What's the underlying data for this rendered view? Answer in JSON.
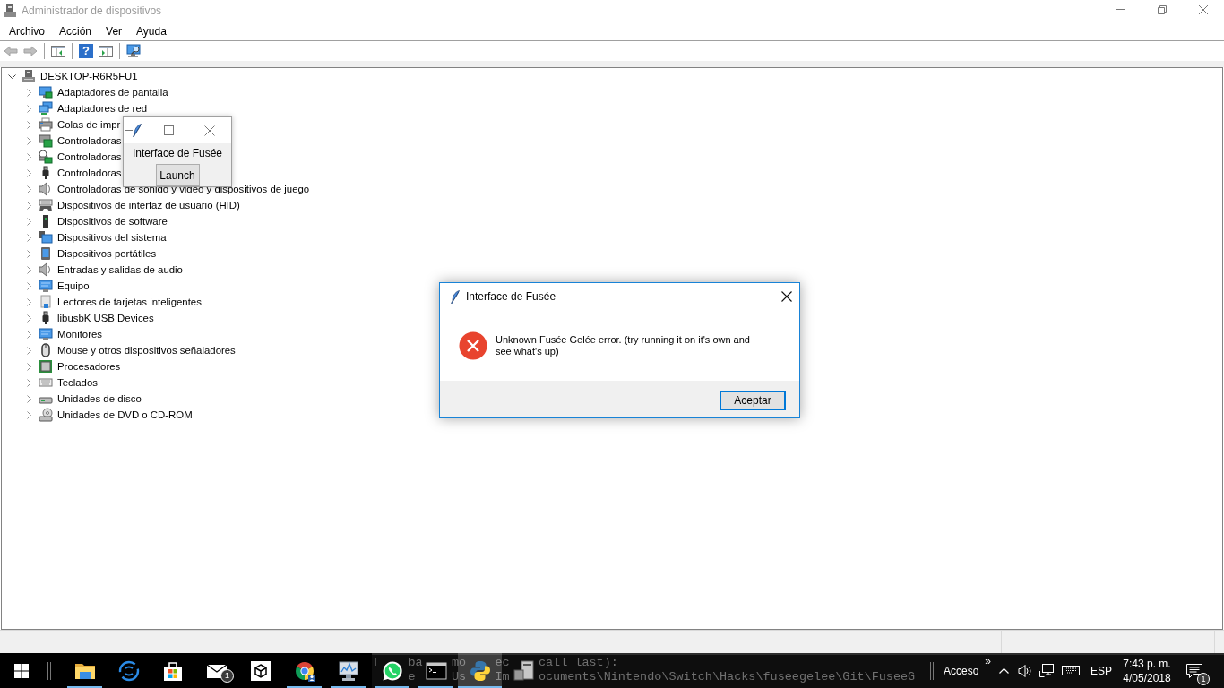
{
  "window": {
    "title": "Administrador de dispositivos"
  },
  "menu": [
    "Archivo",
    "Acción",
    "Ver",
    "Ayuda"
  ],
  "toolbar": {
    "groups": [
      [
        {
          "kind": "back",
          "disabled": true
        },
        {
          "kind": "forward",
          "disabled": true
        }
      ],
      [
        {
          "kind": "tree-pane",
          "disabled": false
        }
      ],
      [
        {
          "kind": "help",
          "label": "?",
          "disabled": false
        },
        {
          "kind": "action-pane",
          "disabled": false
        }
      ],
      [
        {
          "kind": "scan",
          "disabled": false
        }
      ]
    ]
  },
  "tree": {
    "root": {
      "label": "DESKTOP-R6R5FU1",
      "expanded": true,
      "children": [
        {
          "label": "Adaptadores de pantalla",
          "kind": "display",
          "expanded": false
        },
        {
          "label": "Adaptadores de red",
          "kind": "network",
          "expanded": false
        },
        {
          "label": "Colas de impr",
          "kind": "printer",
          "expanded": false
        },
        {
          "label": "Controladoras",
          "kind": "controller",
          "expanded": false
        },
        {
          "label": "Controladoras",
          "kind": "storage",
          "expanded": false
        },
        {
          "label": "Controladoras",
          "kind": "usb",
          "expanded": false
        },
        {
          "label": "Controladoras de sonido y video y dispositivos de juego",
          "kind": "sound",
          "expanded": false
        },
        {
          "label": "Dispositivos de interfaz de usuario (HID)",
          "kind": "hid",
          "expanded": false
        },
        {
          "label": "Dispositivos de software",
          "kind": "software",
          "expanded": false
        },
        {
          "label": "Dispositivos del sistema",
          "kind": "system",
          "expanded": false
        },
        {
          "label": "Dispositivos portátiles",
          "kind": "portable",
          "expanded": false
        },
        {
          "label": "Entradas y salidas de audio",
          "kind": "audio",
          "expanded": false
        },
        {
          "label": "Equipo",
          "kind": "computer",
          "expanded": false
        },
        {
          "label": "Lectores de tarjetas inteligentes",
          "kind": "smartcard",
          "expanded": false
        },
        {
          "label": "libusbK USB Devices",
          "kind": "usb",
          "expanded": false
        },
        {
          "label": "Monitores",
          "kind": "monitor",
          "expanded": false
        },
        {
          "label": "Mouse y otros dispositivos señaladores",
          "kind": "mouse",
          "expanded": false
        },
        {
          "label": "Procesadores",
          "kind": "processor",
          "expanded": false
        },
        {
          "label": "Teclados",
          "kind": "keyboard",
          "expanded": false
        },
        {
          "label": "Unidades de disco",
          "kind": "disk",
          "expanded": false
        },
        {
          "label": "Unidades de DVD o CD-ROM",
          "kind": "dvd",
          "expanded": false
        }
      ]
    }
  },
  "small_window": {
    "label": "Interface de Fusée",
    "button": "Launch"
  },
  "dialog": {
    "title": "Interface de Fusée",
    "message": "Unknown Fusée Gelée error. (try running it on it's own and see what's up)",
    "buttons": [
      {
        "label": "Aceptar",
        "default": true
      }
    ]
  },
  "taskbar": {
    "console_behind": [
      [
        "T",
        "ba",
        "mo",
        "ec",
        "call last):"
      ],
      [
        "e",
        "Us",
        "Im",
        "ocuments\\Nintendo\\Switch\\Hacks\\fuseegelee\\Git\\FuseeG"
      ]
    ],
    "apps": [
      {
        "kind": "folder",
        "running": true,
        "active": false
      },
      {
        "kind": "ring",
        "running": false,
        "active": false
      },
      {
        "kind": "store",
        "running": false,
        "active": false
      },
      {
        "kind": "mail",
        "running": false,
        "active": false,
        "badge": "1"
      },
      {
        "kind": "cube",
        "running": false,
        "active": false
      },
      {
        "kind": "browser",
        "running": true,
        "active": false
      },
      {
        "kind": "chart",
        "running": true,
        "active": false
      },
      {
        "kind": "chat",
        "running": true,
        "active": false
      },
      {
        "kind": "terminal",
        "running": true,
        "active": false
      },
      {
        "kind": "script",
        "running": true,
        "active": true
      },
      {
        "kind": "device",
        "running": false,
        "active": false
      }
    ],
    "tray": {
      "toolbar_label": "Acceso",
      "overflow": "»",
      "language": "ESP",
      "time": "7:43 p. m.",
      "date": "4/05/2018",
      "notification_badge": "1"
    }
  }
}
